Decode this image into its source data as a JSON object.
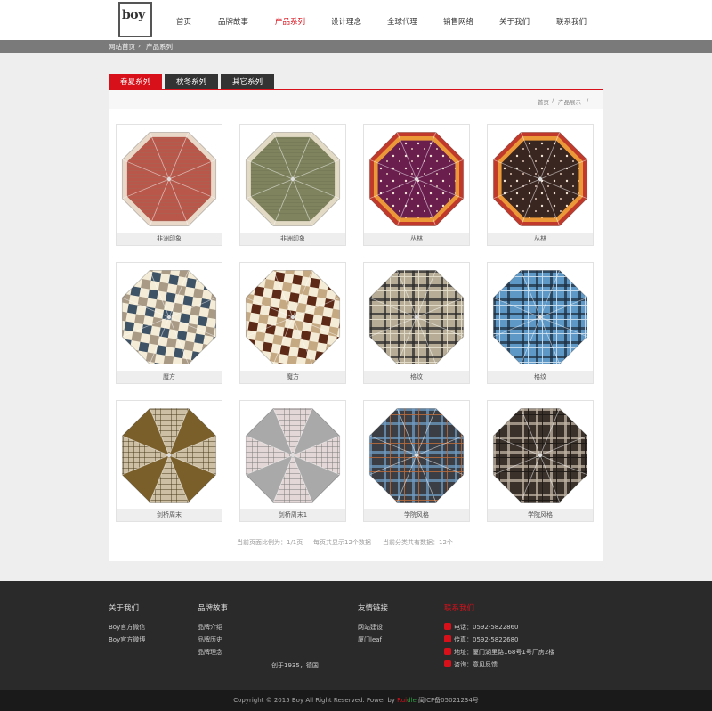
{
  "header": {
    "logo_text": "boy",
    "nav": [
      {
        "label": "首页",
        "active": false
      },
      {
        "label": "品牌故事",
        "active": false
      },
      {
        "label": "产品系列",
        "active": true
      },
      {
        "label": "设计理念",
        "active": false
      },
      {
        "label": "全球代理",
        "active": false
      },
      {
        "label": "销售网络",
        "active": false
      },
      {
        "label": "关于我们",
        "active": false
      },
      {
        "label": "联系我们",
        "active": false
      }
    ]
  },
  "breadcrumb": {
    "home": "网站首页",
    "sep": "›",
    "current": "产品系列"
  },
  "tabs": [
    {
      "label": "春夏系列",
      "active": true
    },
    {
      "label": "秋冬系列",
      "active": false
    },
    {
      "label": "其它系列",
      "active": false
    }
  ],
  "sub_breadcrumb": {
    "home": "首页",
    "sep": "/",
    "current": "产品展示",
    "sep2": "/"
  },
  "products": [
    {
      "name": "非洲印象",
      "pattern": "africa",
      "colors": [
        "#b8574a",
        "#e9d9c9",
        "#9a6d5b"
      ]
    },
    {
      "name": "非洲印象",
      "pattern": "africa",
      "colors": [
        "#7f845e",
        "#e3dac6",
        "#6b6a4e"
      ]
    },
    {
      "name": "丛林",
      "pattern": "floral",
      "colors": [
        "#6a1e4e",
        "#c0392b",
        "#f2a93b"
      ]
    },
    {
      "name": "丛林",
      "pattern": "floral",
      "colors": [
        "#3a2620",
        "#c0392b",
        "#f2a93b"
      ]
    },
    {
      "name": "魔方",
      "pattern": "checker",
      "colors": [
        "#f4ecd6",
        "#3f5366",
        "#a99a86"
      ]
    },
    {
      "name": "魔方",
      "pattern": "checker",
      "colors": [
        "#f4ecd6",
        "#5c2a17",
        "#c5a983"
      ]
    },
    {
      "name": "格纹",
      "pattern": "plaid",
      "colors": [
        "#b7ad96",
        "#2a2a2a",
        "#e6dfcc"
      ]
    },
    {
      "name": "格纹",
      "pattern": "plaid",
      "colors": [
        "#5d98c7",
        "#1e2f40",
        "#cde1ef"
      ]
    },
    {
      "name": "剑桥周末",
      "pattern": "wedge",
      "colors": [
        "#7a5f2a",
        "#cdbfa3",
        "#4a3b1c"
      ]
    },
    {
      "name": "剑桥周末1",
      "pattern": "wedge",
      "colors": [
        "#a9a9a9",
        "#e3d7d7",
        "#7b7b7b"
      ]
    },
    {
      "name": "学院风格",
      "pattern": "plaid",
      "colors": [
        "#3b3f45",
        "#6e9bc2",
        "#b36a3d"
      ]
    },
    {
      "name": "学院风格",
      "pattern": "plaid",
      "colors": [
        "#3a312b",
        "#bfb3a3",
        "#1e1915"
      ]
    }
  ],
  "pager": {
    "page": "当前页面比例为：1/1页",
    "per_page": "每页共显示12个数据",
    "total": "当前分类共有数据：12个"
  },
  "footer": {
    "about": {
      "title": "关于我们",
      "links": [
        "Boy官方微信",
        "Boy官方微博"
      ]
    },
    "story": {
      "title": "品牌故事",
      "links": [
        "品牌介绍",
        "品牌历史",
        "品牌理念"
      ]
    },
    "founded": "创于1935，德国",
    "friends": {
      "title": "友情链接",
      "links": [
        "网站建设",
        "厦门leaf"
      ]
    },
    "contact": {
      "title": "联系我们",
      "phone": "电话：0592-5822860",
      "fax": "传真：0592-5822680",
      "address": "地址：厦门湖里路168号1号厂房2楼",
      "feedback": "咨询：意见反馈"
    }
  },
  "copyright": {
    "text": "Copyright © 2015 Boy All Right Reserved. Power by ",
    "brand_a": "Rui",
    "brand_b": "dle",
    "icp": " 闽ICP备05021234号"
  }
}
